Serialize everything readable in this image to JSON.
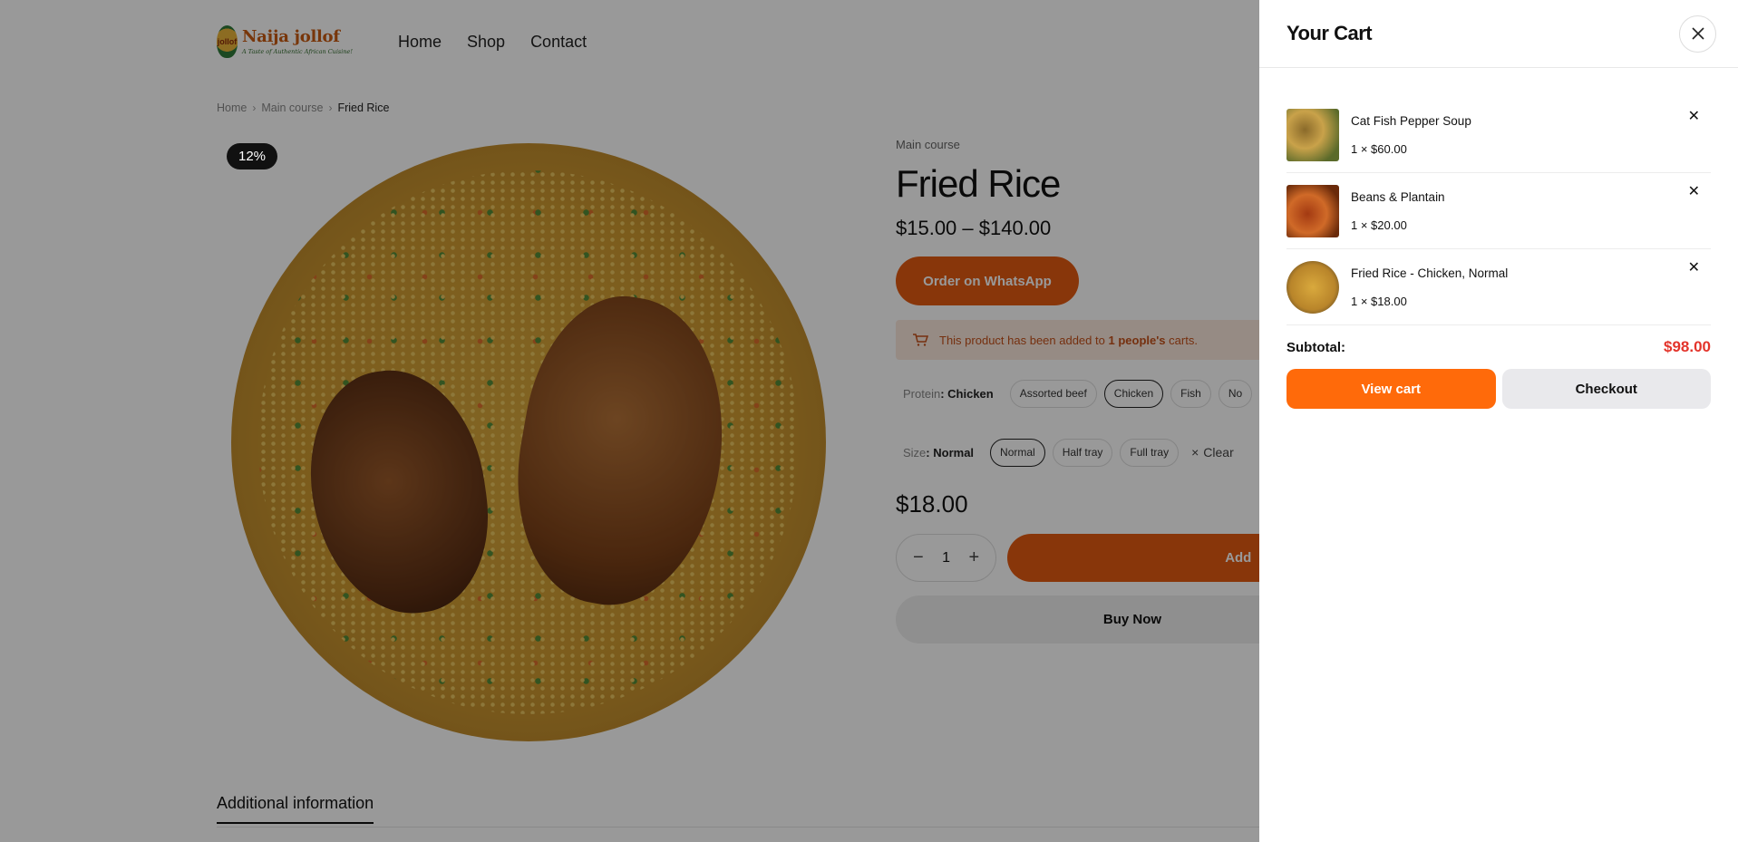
{
  "brand": {
    "name": "Naija jollof",
    "tagline": "A Taste of Authentic African Cuisine!",
    "badge_text": "jollof",
    "accent": "#e35a12"
  },
  "nav": [
    {
      "label": "Home"
    },
    {
      "label": "Shop"
    },
    {
      "label": "Contact"
    }
  ],
  "breadcrumb": {
    "items": [
      "Home",
      "Main course"
    ],
    "current": "Fried Rice",
    "separator": "›"
  },
  "product": {
    "discount_badge": "12%",
    "category": "Main course",
    "title": "Fried Rice",
    "price_range": "$15.00 – $140.00",
    "whatsapp_label": "Order on WhatsApp",
    "notice": {
      "prefix": "This product has been added to",
      "count": "1 people's",
      "suffix": "carts."
    },
    "protein": {
      "label": "Protein",
      "selected": "Chicken",
      "options": [
        "Assorted beef",
        "Chicken",
        "Fish",
        "No"
      ]
    },
    "size": {
      "label": "Size",
      "selected": "Normal",
      "options": [
        "Normal",
        "Half tray",
        "Full tray"
      ],
      "clear_label": "Clear"
    },
    "variation_price": "$18.00",
    "quantity": "1",
    "add_label": "Add",
    "buy_now_label": "Buy Now"
  },
  "tabs": {
    "active": "Additional information"
  },
  "cart": {
    "title": "Your Cart",
    "items": [
      {
        "name": "Cat Fish Pepper Soup",
        "qty_price": "1 × $60.00"
      },
      {
        "name": "Beans & Plantain",
        "qty_price": "1 × $20.00"
      },
      {
        "name": "Fried Rice - Chicken, Normal",
        "qty_price": "1 × $18.00"
      }
    ],
    "subtotal_label": "Subtotal:",
    "subtotal_value": "$98.00",
    "view_cart_label": "View cart",
    "checkout_label": "Checkout",
    "colors": {
      "view_cart": "#ff6a0a",
      "subtotal": "#e3342b",
      "checkout": "#e9e9ec"
    }
  },
  "icons": {
    "close": "close-icon",
    "remove": "remove-icon",
    "cart": "cart-icon",
    "minus": "minus-icon",
    "plus": "plus-icon",
    "chevron": "chevron-right-icon"
  }
}
